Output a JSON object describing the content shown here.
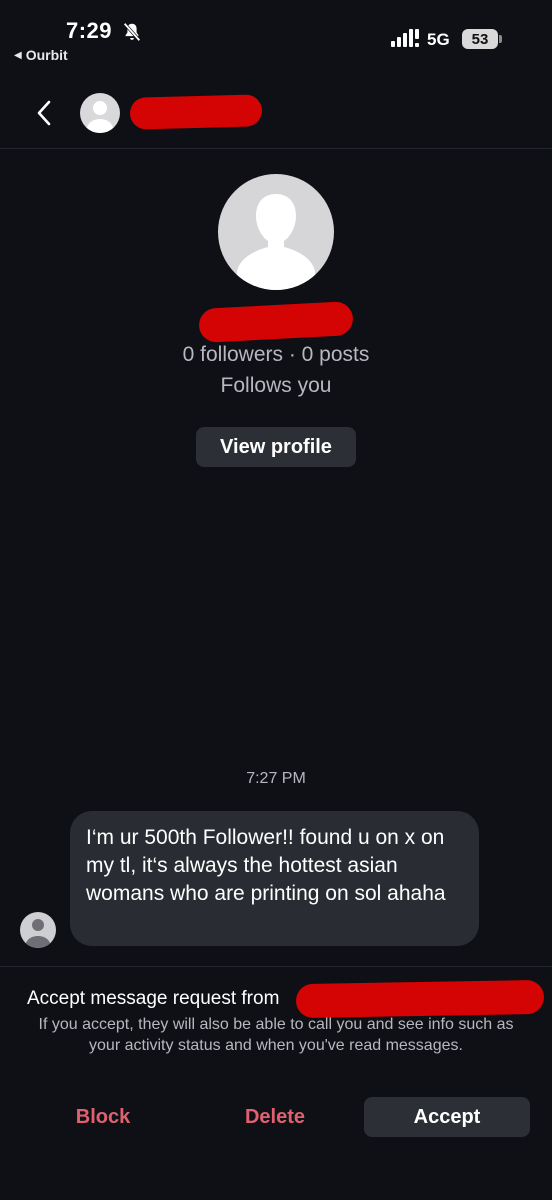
{
  "status_bar": {
    "time": "7:29",
    "back_app": "Ourbit",
    "network": "5G",
    "battery": "53"
  },
  "header": {
    "username": ""
  },
  "profile": {
    "name": "",
    "stats": "0 followers · 0 posts",
    "follows_you": "Follows you",
    "view_profile_label": "View profile"
  },
  "conversation": {
    "timestamp": "7:27 PM",
    "message": "I‘m ur 500th Follower!! found u on x on my tl, it‘s always the hottest asian womans who are printing on sol ahaha"
  },
  "request": {
    "title": "Accept message request from",
    "body": "If you accept, they will also be able to call you and see info such as your activity status and when you've read messages.",
    "block_label": "Block",
    "delete_label": "Delete",
    "accept_label": "Accept"
  },
  "colors": {
    "background": "#0f1015",
    "destructive": "#e0606f",
    "button_bg": "#2d2f36",
    "redaction": "#d40404"
  }
}
